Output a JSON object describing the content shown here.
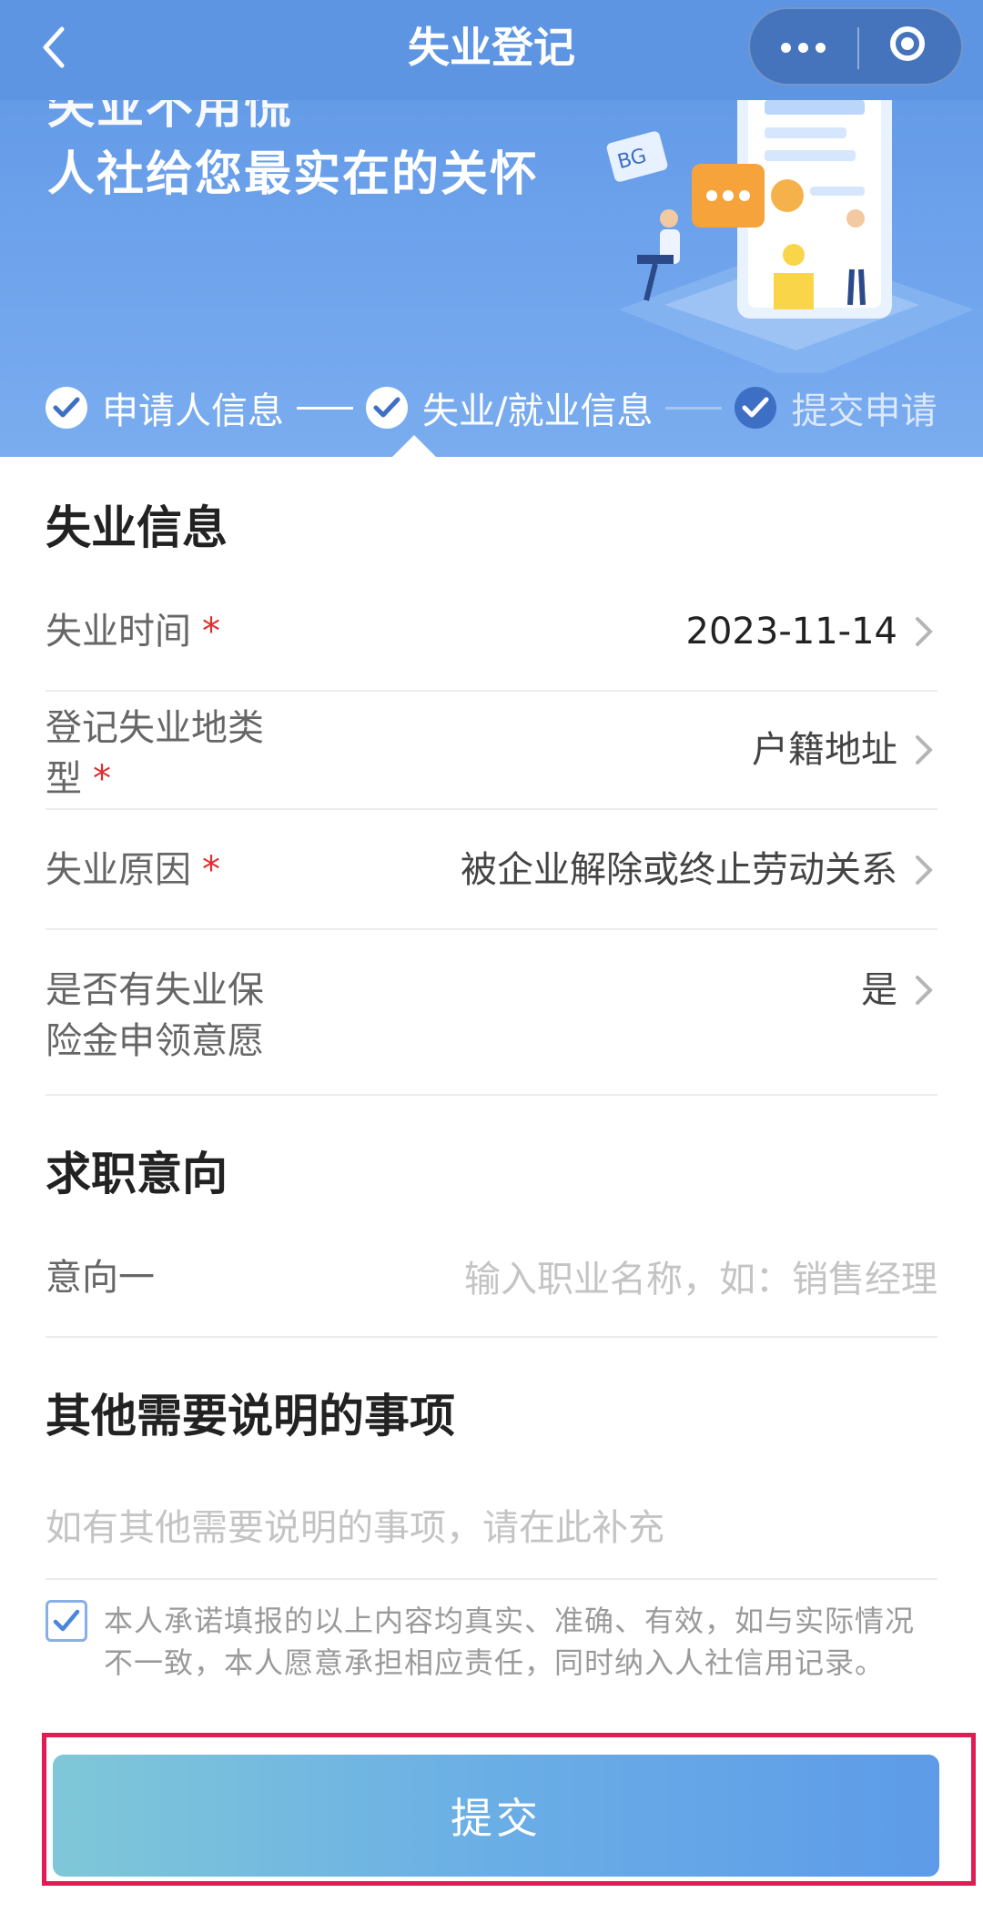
{
  "navbar": {
    "title": "失业登记"
  },
  "banner": {
    "slogan_line1": "失业不用慌",
    "slogan_line2": "人社给您最实在的关怀",
    "steps": [
      {
        "label": "申请人信息",
        "status": "done"
      },
      {
        "label": "失业/就业信息",
        "status": "current"
      },
      {
        "label": "提交申请",
        "status": "pending"
      }
    ]
  },
  "unemployment_section": {
    "title": "失业信息",
    "rows": [
      {
        "label": "失业时间",
        "value": "2023-11-14",
        "required": true
      },
      {
        "label": "登记失业地类型",
        "value": "户籍地址",
        "required": true
      },
      {
        "label": "失业原因",
        "value": "被企业解除或终止劳动关系",
        "required": true
      },
      {
        "label": "是否有失业保险金申领意愿",
        "value": "是",
        "required": false
      }
    ]
  },
  "job_intention_section": {
    "title": "求职意向",
    "intention1_label": "意向一",
    "intention1_placeholder": "输入职业名称，如：销售经理",
    "intention1_value": ""
  },
  "other_section": {
    "title": "其他需要说明的事项",
    "placeholder": "如有其他需要说明的事项，请在此补充",
    "value": ""
  },
  "agreement": {
    "checked": true,
    "text": "本人承诺填报的以上内容均真实、准确、有效，如与实际情况不一致，本人愿意承担相应责任，同时纳入人社信用记录。"
  },
  "submit_label": "提交",
  "colors": {
    "primary": "#5d95e3",
    "required_star": "#e02d2d",
    "highlight_frame": "#e31b54"
  }
}
